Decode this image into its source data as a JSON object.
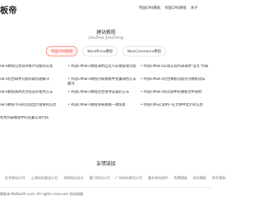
{
  "header": {
    "logo": "板帝",
    "nav": [
      "帝国CMS模板",
      "帝国CMS教程",
      "关于"
    ]
  },
  "section": {
    "title": "建站教程",
    "subtitle": "JianZhan JiaoCheng"
  },
  "tabs": [
    "帝国CMS教程",
    "WordPress教程",
    "WooCommerce教程"
  ],
  "articles": [
    [
      "S8.0教程信息简单统计功能的实现",
      "• 帝国CMS8.0教程调用自定义前端管理页面",
      "• 帝国CMS8.0实现实现目录调用\"首页\"列表"
    ],
    [
      "S8.0后台缺失页面标题问题解决",
      "• 帝国CMS8.0教程列表模板中变量调用方法解决",
      "• 帝国CMS8.0后台模板页面分页模板错误"
    ],
    [
      "S8.0教程调用灵活标签的使用方法",
      "• 帝国CMS8.0教程后台使用设置的方法",
      "• 帝国CMS8.0的页面中的模板文件调用"
    ],
    [
      "S8.0教程不同的页面显示需要的信息",
      "• 帝国CMS8.0教程系统模板一键恢复",
      "• 帝国CMS实现用户在文章中显示的信息"
    ],
    [
      "利用列表模板中的变量实现代码",
      "",
      ""
    ]
  ],
  "friends": {
    "title": "友情链接",
    "links": [
      "北京建站公司",
      "上海网站建设公司",
      "深圳网站设计",
      "厦门网站公司",
      "广州网站建设公司",
      "重庆网站制作",
      "免费模板",
      "网站模板",
      "网页模板"
    ]
  },
  "footer": {
    "copyright": "模板帝 MoBanDi.com. All rights reserved. 网站地图"
  }
}
